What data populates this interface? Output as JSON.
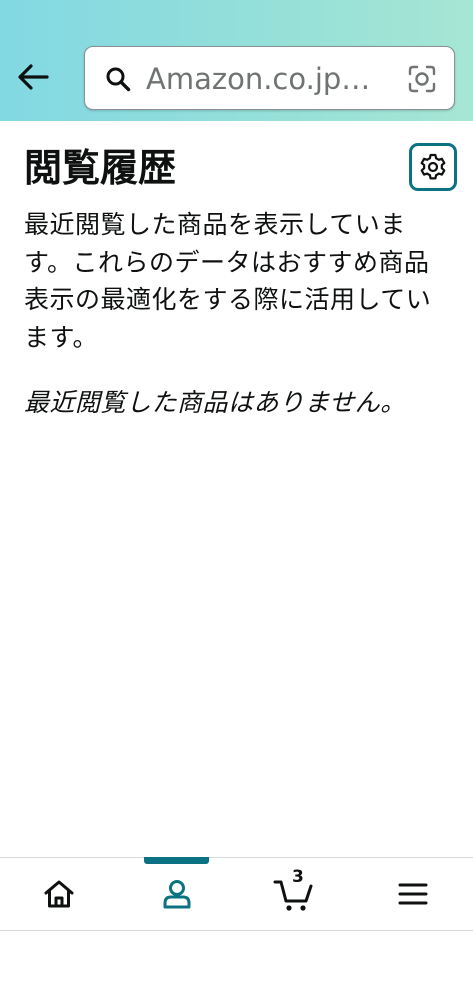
{
  "search": {
    "placeholder": "Amazon.co.jp…"
  },
  "page": {
    "title": "閲覧履歴",
    "description": "最近閲覧した商品を表示しています。これらのデータはおすすめ商品表示の最適化をする際に活用しています。",
    "empty_message": "最近閲覧した商品はありません。"
  },
  "cart": {
    "count": "3"
  },
  "colors": {
    "accent": "#0b7283",
    "header_gradient_start": "#82d8e3",
    "header_gradient_end": "#a6e6d4"
  },
  "icons": {
    "back": "arrow-left-icon",
    "search": "search-icon",
    "lens": "camera-lens-icon",
    "settings": "gear-icon",
    "home": "home-icon",
    "account": "person-icon",
    "cart": "cart-icon",
    "menu": "hamburger-menu-icon"
  },
  "nav": {
    "active": "account"
  }
}
